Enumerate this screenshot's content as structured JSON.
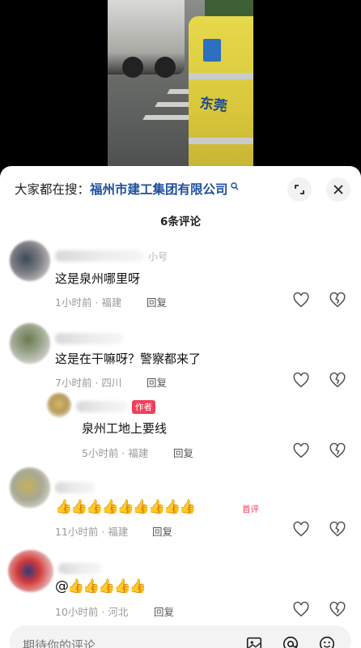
{
  "search": {
    "prefix": "大家都在搜：",
    "keyword": "福州市建工集团有限公司",
    "search_icon": "search-icon"
  },
  "header": {
    "comment_count": "6条评论",
    "expand_icon": "expand-icon",
    "close_icon": "close-icon"
  },
  "video": {
    "worker_vest_text": "东莞"
  },
  "comments": [
    {
      "tag": "小号",
      "text": "这是泉州哪里呀",
      "time": "1小时前",
      "location": "福建",
      "reply": "回复"
    },
    {
      "text": "这是在干嘛呀？警察都来了",
      "time": "7小时前",
      "location": "四川",
      "reply": "回复",
      "replies": [
        {
          "badge": "作者",
          "text": "泉州工地上要线",
          "time": "5小时前",
          "location": "福建",
          "reply": "回复"
        }
      ]
    },
    {
      "text": "👍👍👍👍👍👍👍👍👍",
      "badge": "首评",
      "time": "11小时前",
      "location": "福建",
      "reply": "回复"
    },
    {
      "text": "@👍👍👍👍👍",
      "time": "10小时前",
      "location": "河北",
      "reply": "回复"
    }
  ],
  "input": {
    "placeholder": "期待你的评论",
    "icons": [
      "image-icon",
      "at-icon",
      "emoji-icon"
    ]
  },
  "colors": {
    "keyword": "#1d4f9c",
    "author_badge": "#f2405a",
    "meta": "#9a9a9a"
  }
}
